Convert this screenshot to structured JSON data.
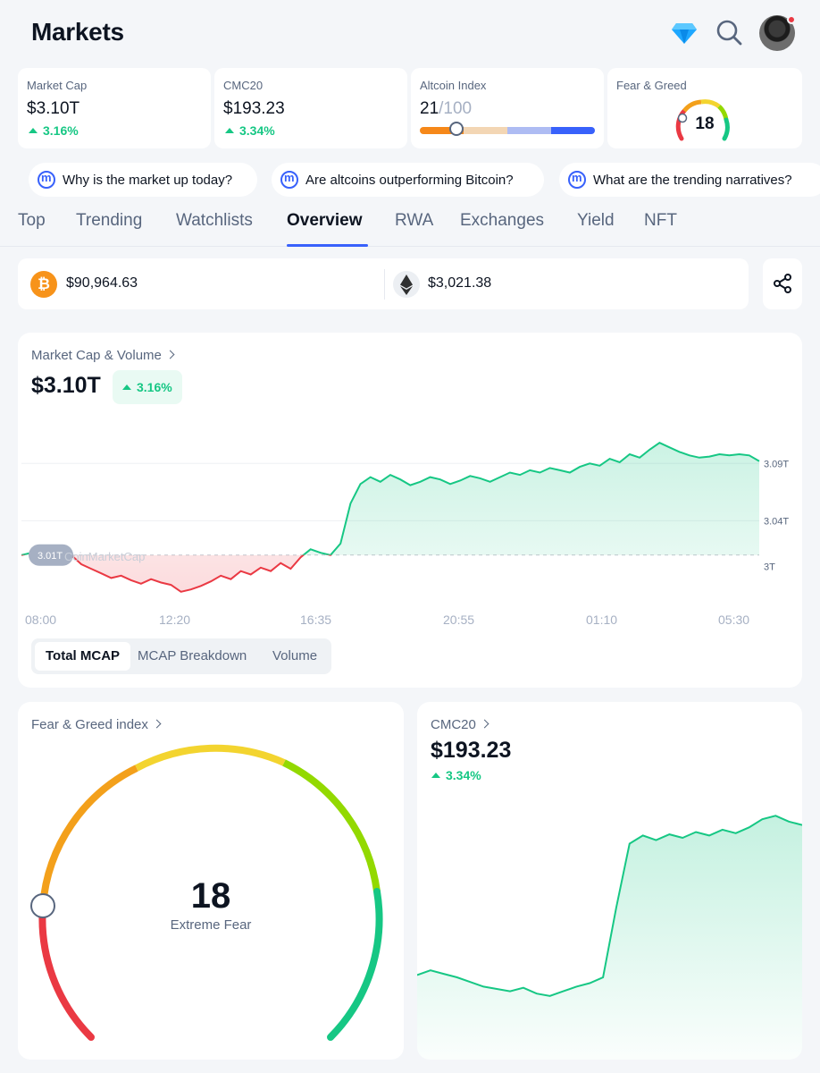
{
  "header": {
    "title": "Markets"
  },
  "stats": {
    "market_cap": {
      "label": "Market Cap",
      "value": "$3.10T",
      "change": "3.16%"
    },
    "cmc20": {
      "label": "CMC20",
      "value": "$193.23",
      "change": "3.34%"
    },
    "altcoin": {
      "label": "Altcoin Index",
      "value": "21",
      "max": "/100",
      "level": 0.21
    },
    "fear_greed": {
      "label": "Fear & Greed",
      "value": "18",
      "level": 0.18
    }
  },
  "chips": [
    "Why is the market up today?",
    "Are altcoins outperforming Bitcoin?",
    "What are the trending narratives?"
  ],
  "tabs": [
    "Top",
    "Trending",
    "Watchlists",
    "Overview",
    "RWA",
    "Exchanges",
    "Yield",
    "NFT"
  ],
  "active_tab": "Overview",
  "prices": {
    "btc": "$90,964.63",
    "btc_symbol": "₿",
    "eth": "$3,021.38"
  },
  "mcap_section": {
    "label": "Market Cap & Volume",
    "value": "$3.10T",
    "change": "3.16%",
    "baseline_label": "3.01T",
    "watermark": "CoinMarketCap",
    "segments": [
      "Total MCAP",
      "MCAP Breakdown",
      "Volume"
    ],
    "active_segment": "Total MCAP"
  },
  "fg_section": {
    "label": "Fear & Greed index",
    "value": "18",
    "status": "Extreme Fear"
  },
  "cmc_section": {
    "label": "CMC20",
    "value": "$193.23",
    "change": "3.34%"
  },
  "colors": {
    "up": "#16c784",
    "down": "#ea3943",
    "accent": "#3861fb"
  },
  "chart_data": [
    {
      "type": "area",
      "title": "Market Cap & Volume",
      "x_ticks": [
        "08:00",
        "12:20",
        "16:35",
        "20:55",
        "01:10",
        "05:30"
      ],
      "y_ticks": [
        "3T",
        "3.04T",
        "3.09T"
      ],
      "baseline": 3.01,
      "ylim": [
        2.97,
        3.13
      ],
      "unit": "T",
      "values": [
        3.01,
        3.012,
        3.008,
        3.011,
        3.015,
        3.01,
        3.002,
        2.998,
        2.994,
        2.99,
        2.992,
        2.988,
        2.985,
        2.989,
        2.986,
        2.984,
        2.978,
        2.98,
        2.983,
        2.987,
        2.992,
        2.989,
        2.996,
        2.993,
        2.999,
        2.996,
        3.003,
        2.998,
        3.008,
        3.015,
        3.012,
        3.01,
        3.02,
        3.055,
        3.072,
        3.078,
        3.074,
        3.08,
        3.076,
        3.071,
        3.074,
        3.078,
        3.076,
        3.072,
        3.075,
        3.079,
        3.077,
        3.074,
        3.078,
        3.082,
        3.08,
        3.084,
        3.082,
        3.086,
        3.084,
        3.082,
        3.087,
        3.09,
        3.088,
        3.094,
        3.091,
        3.098,
        3.095,
        3.102,
        3.108,
        3.104,
        3.1,
        3.097,
        3.095,
        3.096,
        3.098,
        3.097,
        3.098,
        3.097,
        3.092
      ]
    },
    {
      "type": "area",
      "title": "CMC20",
      "values": [
        180.2,
        180.6,
        180.3,
        180.0,
        179.6,
        179.2,
        179.0,
        178.8,
        179.1,
        178.6,
        178.4,
        178.8,
        179.2,
        179.5,
        180.0,
        186.0,
        191.5,
        192.2,
        191.8,
        192.3,
        192.0,
        192.5,
        192.2,
        192.7,
        192.4,
        192.9,
        193.6,
        193.9,
        193.4,
        193.1
      ]
    }
  ]
}
